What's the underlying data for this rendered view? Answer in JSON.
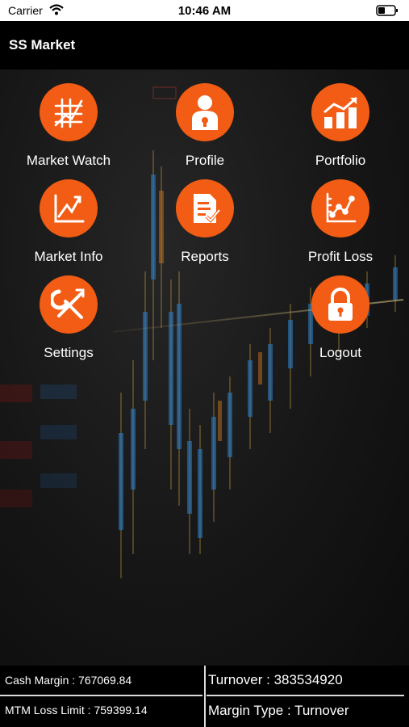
{
  "status_bar": {
    "carrier": "Carrier",
    "time": "10:46 AM"
  },
  "app": {
    "title": "SS Market"
  },
  "menu": {
    "market_watch": "Market Watch",
    "profile": "Profile",
    "portfolio": "Portfolio",
    "market_info": "Market Info",
    "reports": "Reports",
    "profit_loss": "Profit Loss",
    "settings": "Settings",
    "logout": "Logout"
  },
  "footer": {
    "cash_margin": "Cash Margin : 767069.84",
    "mtm_loss_limit": "MTM Loss Limit : 759399.14",
    "turnover": "Turnover : 383534920",
    "margin_type": "Margin Type : Turnover"
  },
  "theme": {
    "accent": "#f25c14",
    "header_bg": "#000000",
    "text": "#ffffff"
  }
}
